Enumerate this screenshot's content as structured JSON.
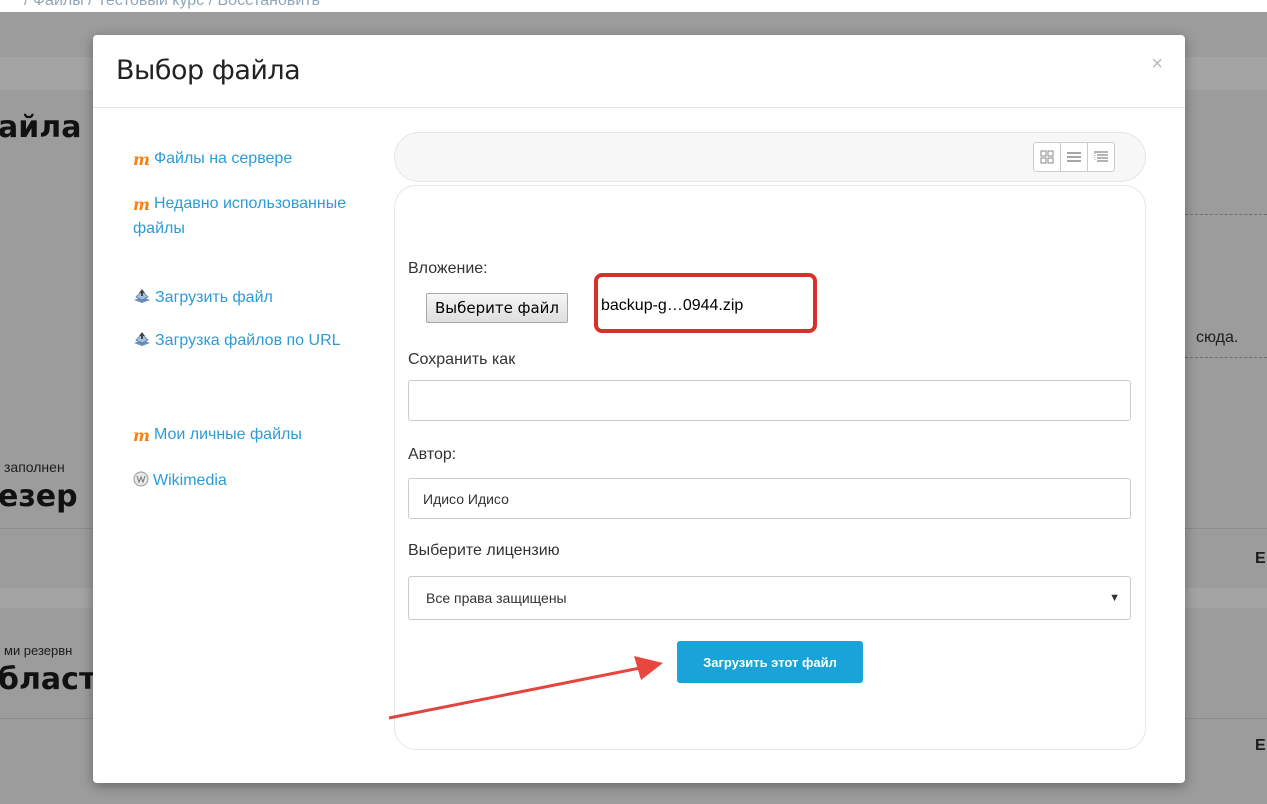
{
  "background": {
    "breadcrumb": "/ Файлы / Тестовый курс / Восстановить",
    "heading_1": "айла",
    "text_filled": "заполнен",
    "heading_2": "езер",
    "text_backups": "ми резервн",
    "heading_3": "бласт",
    "text_drop": "сюда.",
    "edge_letter_1": "E",
    "edge_letter_2": "E"
  },
  "modal": {
    "title": "Выбор файла",
    "close": "×"
  },
  "repositories": [
    {
      "label": "Файлы на сервере",
      "icon": "moodle-icon"
    },
    {
      "label": "Недавно использованные файлы",
      "icon": "moodle-icon"
    },
    {
      "label": "Загрузить файл",
      "icon": "upload-icon"
    },
    {
      "label": "Загрузка файлов по URL",
      "icon": "url-download-icon"
    },
    {
      "label": "Мои личные файлы",
      "icon": "moodle-icon"
    },
    {
      "label": "Wikimedia",
      "icon": "wikimedia-icon"
    }
  ],
  "view_buttons": [
    "icons-view-icon",
    "list-view-icon",
    "tree-view-icon"
  ],
  "form": {
    "attachment_label": "Вложение:",
    "choose_file_button": "Выберите файл",
    "chosen_file": "backup-g…0944.zip",
    "save_as_label": "Сохранить как",
    "save_as_value": "",
    "author_label": "Автор:",
    "author_value": "Идисо Идисо",
    "license_label": "Выберите лицензию",
    "license_value": "Все права защищены",
    "upload_button": "Загрузить этот файл"
  },
  "colors": {
    "link": "#2c9bd6",
    "accent_button": "#1aa3d8",
    "highlight": "#d9302b",
    "moodle_orange": "#f98012"
  }
}
